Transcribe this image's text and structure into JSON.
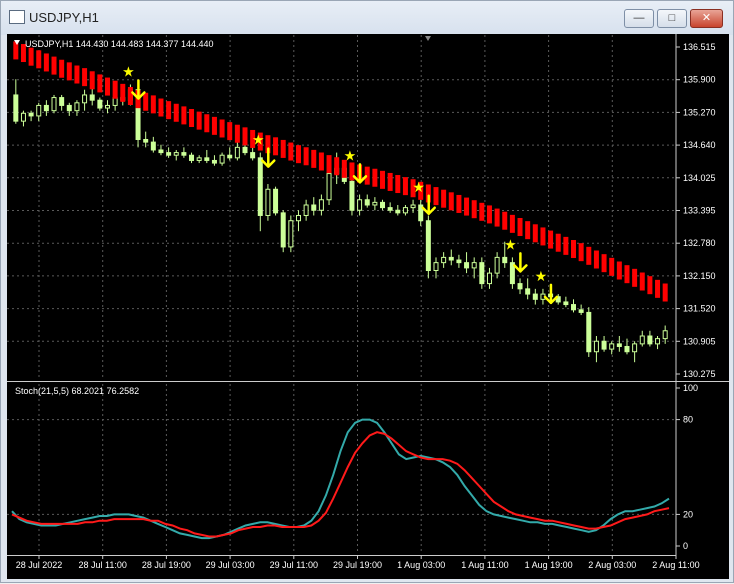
{
  "window": {
    "title": "USDJPY,H1",
    "minimize_label": "—",
    "maximize_label": "□",
    "close_label": "✕"
  },
  "main_panel": {
    "info_label": "USDJPY,H1  144.430 144.483 144.377 144.440",
    "price_ticks": [
      "136.515",
      "135.900",
      "135.270",
      "134.640",
      "134.025",
      "133.395",
      "132.780",
      "132.150",
      "131.520",
      "130.905",
      "130.275"
    ]
  },
  "sub_panel": {
    "info_label": "Stoch(21,5,5) 68.2021 76.2582",
    "level_ticks": [
      "100",
      "80",
      "20",
      "0"
    ]
  },
  "time_ticks": [
    "28 Jul 2022",
    "28 Jul 11:00",
    "28 Jul 19:00",
    "29 Jul 03:00",
    "29 Jul 11:00",
    "29 Jul 19:00",
    "1 Aug 03:00",
    "1 Aug 11:00",
    "1 Aug 19:00",
    "2 Aug 03:00",
    "2 Aug 11:00"
  ],
  "colors": {
    "background": "#000000",
    "grid": "#5a5a5a",
    "candle": "#ccff99",
    "trail": "#ff0000",
    "signal": "#ffff00",
    "stoch_main": "#33aaaa",
    "stoch_signal": "#ff1a1a"
  },
  "chart_data": [
    {
      "type": "candlestick",
      "ylim": [
        130.275,
        136.515
      ],
      "candles": [
        [
          135.6,
          135.9,
          135.05,
          135.1
        ],
        [
          135.1,
          135.3,
          135.0,
          135.25
        ],
        [
          135.25,
          135.3,
          135.1,
          135.2
        ],
        [
          135.2,
          135.45,
          135.1,
          135.4
        ],
        [
          135.4,
          135.5,
          135.2,
          135.3
        ],
        [
          135.3,
          135.6,
          135.25,
          135.55
        ],
        [
          135.55,
          135.6,
          135.3,
          135.4
        ],
        [
          135.4,
          135.45,
          135.2,
          135.3
        ],
        [
          135.3,
          135.5,
          135.2,
          135.45
        ],
        [
          135.45,
          135.7,
          135.3,
          135.6
        ],
        [
          135.6,
          135.75,
          135.4,
          135.5
        ],
        [
          135.5,
          135.55,
          135.3,
          135.35
        ],
        [
          135.35,
          135.5,
          135.25,
          135.4
        ],
        [
          135.4,
          135.6,
          135.3,
          135.55
        ],
        [
          135.55,
          135.65,
          135.4,
          135.5
        ],
        [
          135.5,
          135.8,
          135.4,
          135.7
        ],
        [
          135.7,
          135.75,
          134.6,
          134.75
        ],
        [
          134.75,
          134.9,
          134.6,
          134.7
        ],
        [
          134.7,
          134.8,
          134.5,
          134.55
        ],
        [
          134.55,
          134.65,
          134.45,
          134.5
        ],
        [
          134.5,
          134.6,
          134.4,
          134.45
        ],
        [
          134.45,
          134.55,
          134.35,
          134.5
        ],
        [
          134.5,
          134.6,
          134.4,
          134.45
        ],
        [
          134.45,
          134.5,
          134.3,
          134.35
        ],
        [
          134.35,
          134.45,
          134.3,
          134.4
        ],
        [
          134.4,
          134.55,
          134.3,
          134.35
        ],
        [
          134.35,
          134.45,
          134.25,
          134.3
        ],
        [
          134.3,
          134.5,
          134.25,
          134.45
        ],
        [
          134.45,
          134.6,
          134.35,
          134.4
        ],
        [
          134.4,
          134.7,
          134.35,
          134.6
        ],
        [
          134.6,
          134.75,
          134.45,
          134.5
        ],
        [
          134.5,
          134.6,
          134.35,
          134.4
        ],
        [
          134.4,
          134.5,
          133.0,
          133.3
        ],
        [
          133.3,
          133.9,
          133.2,
          133.8
        ],
        [
          133.8,
          133.85,
          133.3,
          133.35
        ],
        [
          133.35,
          133.4,
          132.6,
          132.7
        ],
        [
          132.7,
          133.3,
          132.6,
          133.2
        ],
        [
          133.2,
          133.4,
          133.0,
          133.3
        ],
        [
          133.3,
          133.6,
          133.2,
          133.5
        ],
        [
          133.5,
          133.65,
          133.3,
          133.4
        ],
        [
          133.4,
          133.7,
          133.3,
          133.6
        ],
        [
          133.6,
          134.2,
          133.5,
          134.1
        ],
        [
          134.1,
          134.5,
          133.9,
          134.2
        ],
        [
          134.2,
          134.3,
          133.9,
          133.95
        ],
        [
          133.95,
          134.2,
          133.3,
          133.4
        ],
        [
          133.4,
          133.7,
          133.3,
          133.6
        ],
        [
          133.6,
          133.7,
          133.45,
          133.5
        ],
        [
          133.5,
          133.65,
          133.4,
          133.55
        ],
        [
          133.55,
          133.6,
          133.4,
          133.45
        ],
        [
          133.45,
          133.55,
          133.35,
          133.4
        ],
        [
          133.4,
          133.5,
          133.3,
          133.35
        ],
        [
          133.35,
          133.5,
          133.3,
          133.45
        ],
        [
          133.45,
          133.6,
          133.35,
          133.5
        ],
        [
          133.5,
          133.6,
          133.1,
          133.2
        ],
        [
          133.2,
          133.3,
          132.1,
          132.25
        ],
        [
          132.25,
          132.5,
          132.1,
          132.4
        ],
        [
          132.4,
          132.6,
          132.3,
          132.5
        ],
        [
          132.5,
          132.65,
          132.35,
          132.45
        ],
        [
          132.45,
          132.55,
          132.3,
          132.4
        ],
        [
          132.4,
          132.6,
          132.2,
          132.3
        ],
        [
          132.3,
          132.5,
          132.1,
          132.4
        ],
        [
          132.4,
          132.5,
          131.9,
          132.0
        ],
        [
          132.0,
          132.3,
          131.9,
          132.2
        ],
        [
          132.2,
          132.6,
          132.1,
          132.5
        ],
        [
          132.5,
          132.8,
          132.3,
          132.4
        ],
        [
          132.4,
          132.5,
          131.9,
          132.0
        ],
        [
          132.0,
          132.1,
          131.8,
          131.9
        ],
        [
          131.9,
          132.1,
          131.7,
          131.8
        ],
        [
          131.8,
          131.9,
          131.6,
          131.7
        ],
        [
          131.7,
          131.9,
          131.6,
          131.8
        ],
        [
          131.8,
          131.9,
          131.65,
          131.75
        ],
        [
          131.75,
          131.8,
          131.6,
          131.65
        ],
        [
          131.65,
          131.75,
          131.55,
          131.6
        ],
        [
          131.6,
          131.7,
          131.45,
          131.5
        ],
        [
          131.5,
          131.6,
          131.4,
          131.45
        ],
        [
          131.45,
          131.55,
          130.6,
          130.7
        ],
        [
          130.7,
          131.0,
          130.5,
          130.9
        ],
        [
          130.9,
          131.0,
          130.7,
          130.75
        ],
        [
          130.75,
          130.9,
          130.65,
          130.85
        ],
        [
          130.85,
          131.0,
          130.7,
          130.8
        ],
        [
          130.8,
          130.95,
          130.65,
          130.7
        ],
        [
          130.7,
          130.9,
          130.5,
          130.85
        ],
        [
          130.85,
          131.1,
          130.8,
          131.0
        ],
        [
          131.0,
          131.1,
          130.8,
          130.85
        ],
        [
          130.85,
          131.0,
          130.75,
          130.95
        ],
        [
          130.95,
          131.2,
          130.85,
          131.1
        ]
      ],
      "trail": [
        136.45,
        136.4,
        136.33,
        136.28,
        136.22,
        136.16,
        136.1,
        136.05,
        135.99,
        135.94,
        135.88,
        135.82,
        135.76,
        135.7,
        135.64,
        135.58,
        135.52,
        135.47,
        135.42,
        135.36,
        135.31,
        135.26,
        135.21,
        135.16,
        135.11,
        135.06,
        135.01,
        134.96,
        134.91,
        134.86,
        134.81,
        134.76,
        134.71,
        134.66,
        134.62,
        134.57,
        134.52,
        134.47,
        134.43,
        134.38,
        134.33,
        134.28,
        134.24,
        134.19,
        134.14,
        134.1,
        134.06,
        134.02,
        133.98,
        133.94,
        133.9,
        133.86,
        133.82,
        133.77,
        133.72,
        133.67,
        133.62,
        133.57,
        133.52,
        133.47,
        133.42,
        133.37,
        133.32,
        133.26,
        133.2,
        133.14,
        133.08,
        133.02,
        132.96,
        132.9,
        132.84,
        132.78,
        132.72,
        132.66,
        132.6,
        132.53,
        132.46,
        132.39,
        132.32,
        132.25,
        132.18,
        132.11,
        132.04,
        131.97,
        131.9,
        131.83
      ],
      "signals": [
        15,
        32,
        44,
        53,
        65,
        69
      ]
    },
    {
      "type": "line",
      "ylim": [
        0,
        100
      ],
      "series": [
        {
          "values": [
            22,
            17,
            15,
            14,
            13,
            13,
            13,
            14,
            15,
            16,
            17,
            18,
            19,
            19,
            20,
            20,
            20,
            19,
            18,
            16,
            14,
            12,
            10,
            8,
            7,
            6,
            5,
            5,
            6,
            7,
            9,
            11,
            13,
            14,
            15,
            15,
            14,
            13,
            12,
            12,
            13,
            16,
            22,
            32,
            45,
            60,
            72,
            78,
            80,
            80,
            78,
            72,
            65,
            58,
            55,
            56,
            57,
            56,
            55,
            53,
            50,
            45,
            38,
            32,
            26,
            22,
            20,
            19,
            18,
            17,
            16,
            15,
            15,
            14,
            14,
            13,
            12,
            11,
            10,
            9,
            10,
            13,
            17,
            20,
            22,
            22,
            23,
            24,
            25,
            27,
            30
          ]
        },
        {
          "values": [
            20,
            18,
            16,
            15,
            14,
            14,
            14,
            14,
            14,
            14,
            15,
            15,
            16,
            16,
            17,
            17,
            17,
            17,
            17,
            16,
            16,
            14,
            13,
            11,
            10,
            8,
            7,
            6,
            6,
            7,
            8,
            10,
            11,
            12,
            12,
            13,
            13,
            12,
            12,
            12,
            12,
            13,
            16,
            21,
            30,
            40,
            50,
            59,
            65,
            70,
            72,
            71,
            68,
            64,
            60,
            58,
            56,
            55,
            55,
            55,
            54,
            52,
            48,
            43,
            38,
            33,
            28,
            25,
            22,
            20,
            19,
            18,
            17,
            16,
            16,
            15,
            14,
            13,
            12,
            11,
            11,
            12,
            13,
            15,
            17,
            18,
            19,
            20,
            22,
            23,
            24
          ]
        }
      ]
    }
  ]
}
